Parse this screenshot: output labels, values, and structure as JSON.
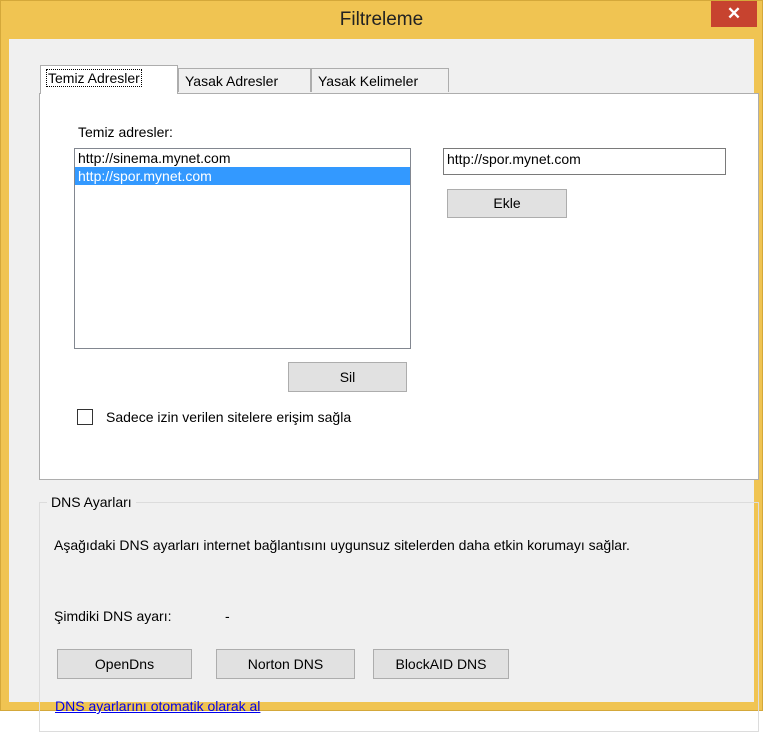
{
  "window": {
    "title": "Filtreleme",
    "close_glyph": "✕"
  },
  "tabs": [
    {
      "label": "Temiz Adresler",
      "active": true
    },
    {
      "label": "Yasak Adresler",
      "active": false
    },
    {
      "label": "Yasak Kelimeler",
      "active": false
    }
  ],
  "clean_addresses": {
    "list_label": "Temiz adresler:",
    "items": [
      "http://sinema.mynet.com",
      "http://spor.mynet.com"
    ],
    "selected_index": 1,
    "input_value": "http://spor.mynet.com",
    "add_button": "Ekle",
    "delete_button": "Sil",
    "checkbox_label": "Sadece izin verilen sitelere erişim sağla",
    "checkbox_checked": false
  },
  "dns": {
    "group_title": "DNS Ayarları",
    "description": "Aşağıdaki DNS ayarları internet bağlantısını uygunsuz sitelerden daha etkin korumayı sağlar.",
    "current_label": "Şimdiki DNS ayarı:",
    "current_value": "-",
    "buttons": [
      "OpenDns",
      "Norton DNS",
      "BlockAID DNS"
    ],
    "auto_link": "DNS ayarlarını otomatik olarak al"
  },
  "colors": {
    "title_bar": "#f0c452",
    "close_button": "#c7432f",
    "selection": "#3399ff"
  }
}
